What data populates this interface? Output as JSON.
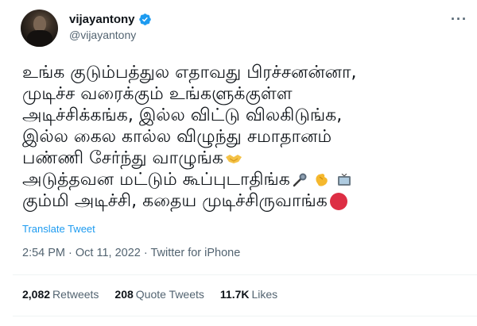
{
  "header": {
    "display_name": "vijayantony",
    "handle": "@vijayantony",
    "more_label": "···"
  },
  "tweet": {
    "lines": [
      "உங்க குடும்பத்துல எதாவது பிரச்சனன்னா,",
      "முடிச்ச வரைக்கும் உங்களுக்குள்ள",
      "அடிச்சிக்கங்க, இல்ல விட்டு விலகிடுங்க,",
      "இல்ல கைல கால்ல விழுந்து சமாதானம்",
      "பண்ணி சேர்ந்து வாழுங்க",
      "அடுத்தவன மட்டும் கூப்புடாதிங்க",
      "கும்மி அடிச்சி, கதைய முடிச்சிருவாங்க"
    ],
    "emojis": [
      "handshake-emoji",
      "microphone-emoji",
      "clapping-hand-emoji",
      "television-emoji",
      "red-circle-emoji"
    ]
  },
  "translate_label": "Translate Tweet",
  "meta": {
    "time": "2:54 PM",
    "separator1": " · ",
    "date": "Oct 11, 2022",
    "separator2": " · ",
    "source": "Twitter for iPhone"
  },
  "stats": {
    "retweets_count": "2,082",
    "retweets_label": "Retweets",
    "quotes_count": "208",
    "quotes_label": "Quote Tweets",
    "likes_count": "11.7K",
    "likes_label": "Likes"
  },
  "colors": {
    "accent": "#1d9bf0",
    "secondary_text": "#536471",
    "primary_text": "#0f1419",
    "divider": "#eff3f4"
  }
}
